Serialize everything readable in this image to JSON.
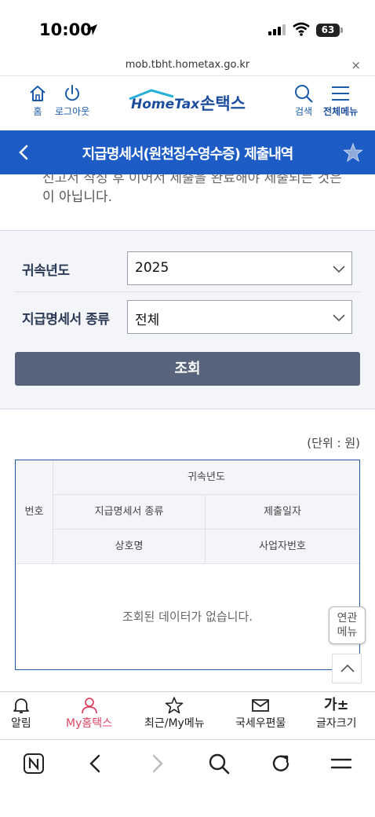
{
  "status_bar": {
    "time": "10:00",
    "battery": "63",
    "icons": [
      "location-arrow-icon",
      "signal-icon",
      "wifi-icon",
      "battery-icon"
    ]
  },
  "browser": {
    "url": "mob.tbht.hometax.go.kr",
    "close_symbol": "×"
  },
  "header": {
    "home_label": "홈",
    "logout_label": "로그아웃",
    "logo_en": "HomeTax",
    "logo_ko": "손택스",
    "search_label": "검색",
    "menu_label": "전체메뉴"
  },
  "page": {
    "title": "지급명세서(원천징수영수증) 제출내역"
  },
  "notice": {
    "cut_line": "신고서 작성 후 이어서 제출을 완료해야 제출되는 것은",
    "line": "이 아닙니다."
  },
  "form": {
    "year_label": "귀속년도",
    "year_value": "2025",
    "type_label": "지급명세서 종류",
    "type_value": "전체",
    "search_button": "조회"
  },
  "results": {
    "unit": "(단위 : 원)",
    "headers": {
      "no": "번호",
      "year": "귀속년도",
      "type": "지급명세서 종류",
      "date": "제출일자",
      "company": "상호명",
      "biz_no": "사업자번호"
    },
    "empty_message": "조회된 데이터가 없습니다."
  },
  "floating": {
    "related_line1": "연관",
    "related_line2": "메뉴"
  },
  "bottom_nav": {
    "items": [
      {
        "label": "알림",
        "icon": "bell-icon"
      },
      {
        "label": "My홈택스",
        "icon": "person-icon"
      },
      {
        "label": "최근/My메뉴",
        "icon": "star-icon"
      },
      {
        "label": "국세우편물",
        "icon": "mail-icon"
      },
      {
        "label": "글자크기",
        "icon": "font-size-icon",
        "glyph": "가±"
      }
    ],
    "active_color": "#d94463"
  },
  "colors": {
    "brand_blue": "#1c5cc4",
    "search_button": "#57647c",
    "panel_bg": "#f4f5f9"
  }
}
